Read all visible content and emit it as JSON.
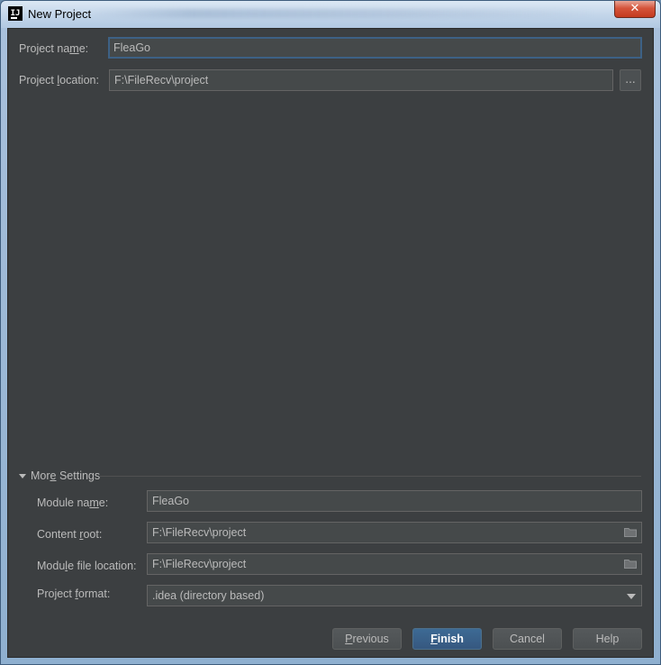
{
  "window": {
    "title": "New Project",
    "close_glyph": "✕"
  },
  "form": {
    "project_name": {
      "label_pre": "Project na",
      "label_mn": "m",
      "label_post": "e:",
      "value": "FleaGo"
    },
    "project_location": {
      "label_pre": "Project ",
      "label_mn": "l",
      "label_post": "ocation:",
      "value": "F:\\FileRecv\\project",
      "browse_label": "..."
    }
  },
  "more_settings": {
    "label_pre": "Mor",
    "label_mn": "e",
    "label_post": " Settings",
    "module_name": {
      "label_pre": "Module na",
      "label_mn": "m",
      "label_post": "e:",
      "value": "FleaGo"
    },
    "content_root": {
      "label_pre": "Content ",
      "label_mn": "r",
      "label_post": "oot:",
      "value": "F:\\FileRecv\\project"
    },
    "module_file_location": {
      "label_pre": "Modu",
      "label_mn": "l",
      "label_post": "e file location:",
      "value": "F:\\FileRecv\\project"
    },
    "project_format": {
      "label_pre": "Project ",
      "label_mn": "f",
      "label_post": "ormat:",
      "value": ".idea (directory based)"
    }
  },
  "buttons": {
    "previous": {
      "mn": "P",
      "rest": "revious"
    },
    "finish": {
      "mn": "F",
      "rest": "inish"
    },
    "cancel": "Cancel",
    "help": "Help"
  },
  "icons": {
    "app": "intellij-idea-icon",
    "folder": "folder-icon",
    "dropdown": "chevron-down-icon",
    "collapse": "triangle-down-icon"
  },
  "colors": {
    "background": "#3c3f41",
    "field": "#45494a",
    "focus_border": "#3d6185",
    "primary_button": "#365880",
    "text": "#bbbbbb"
  }
}
